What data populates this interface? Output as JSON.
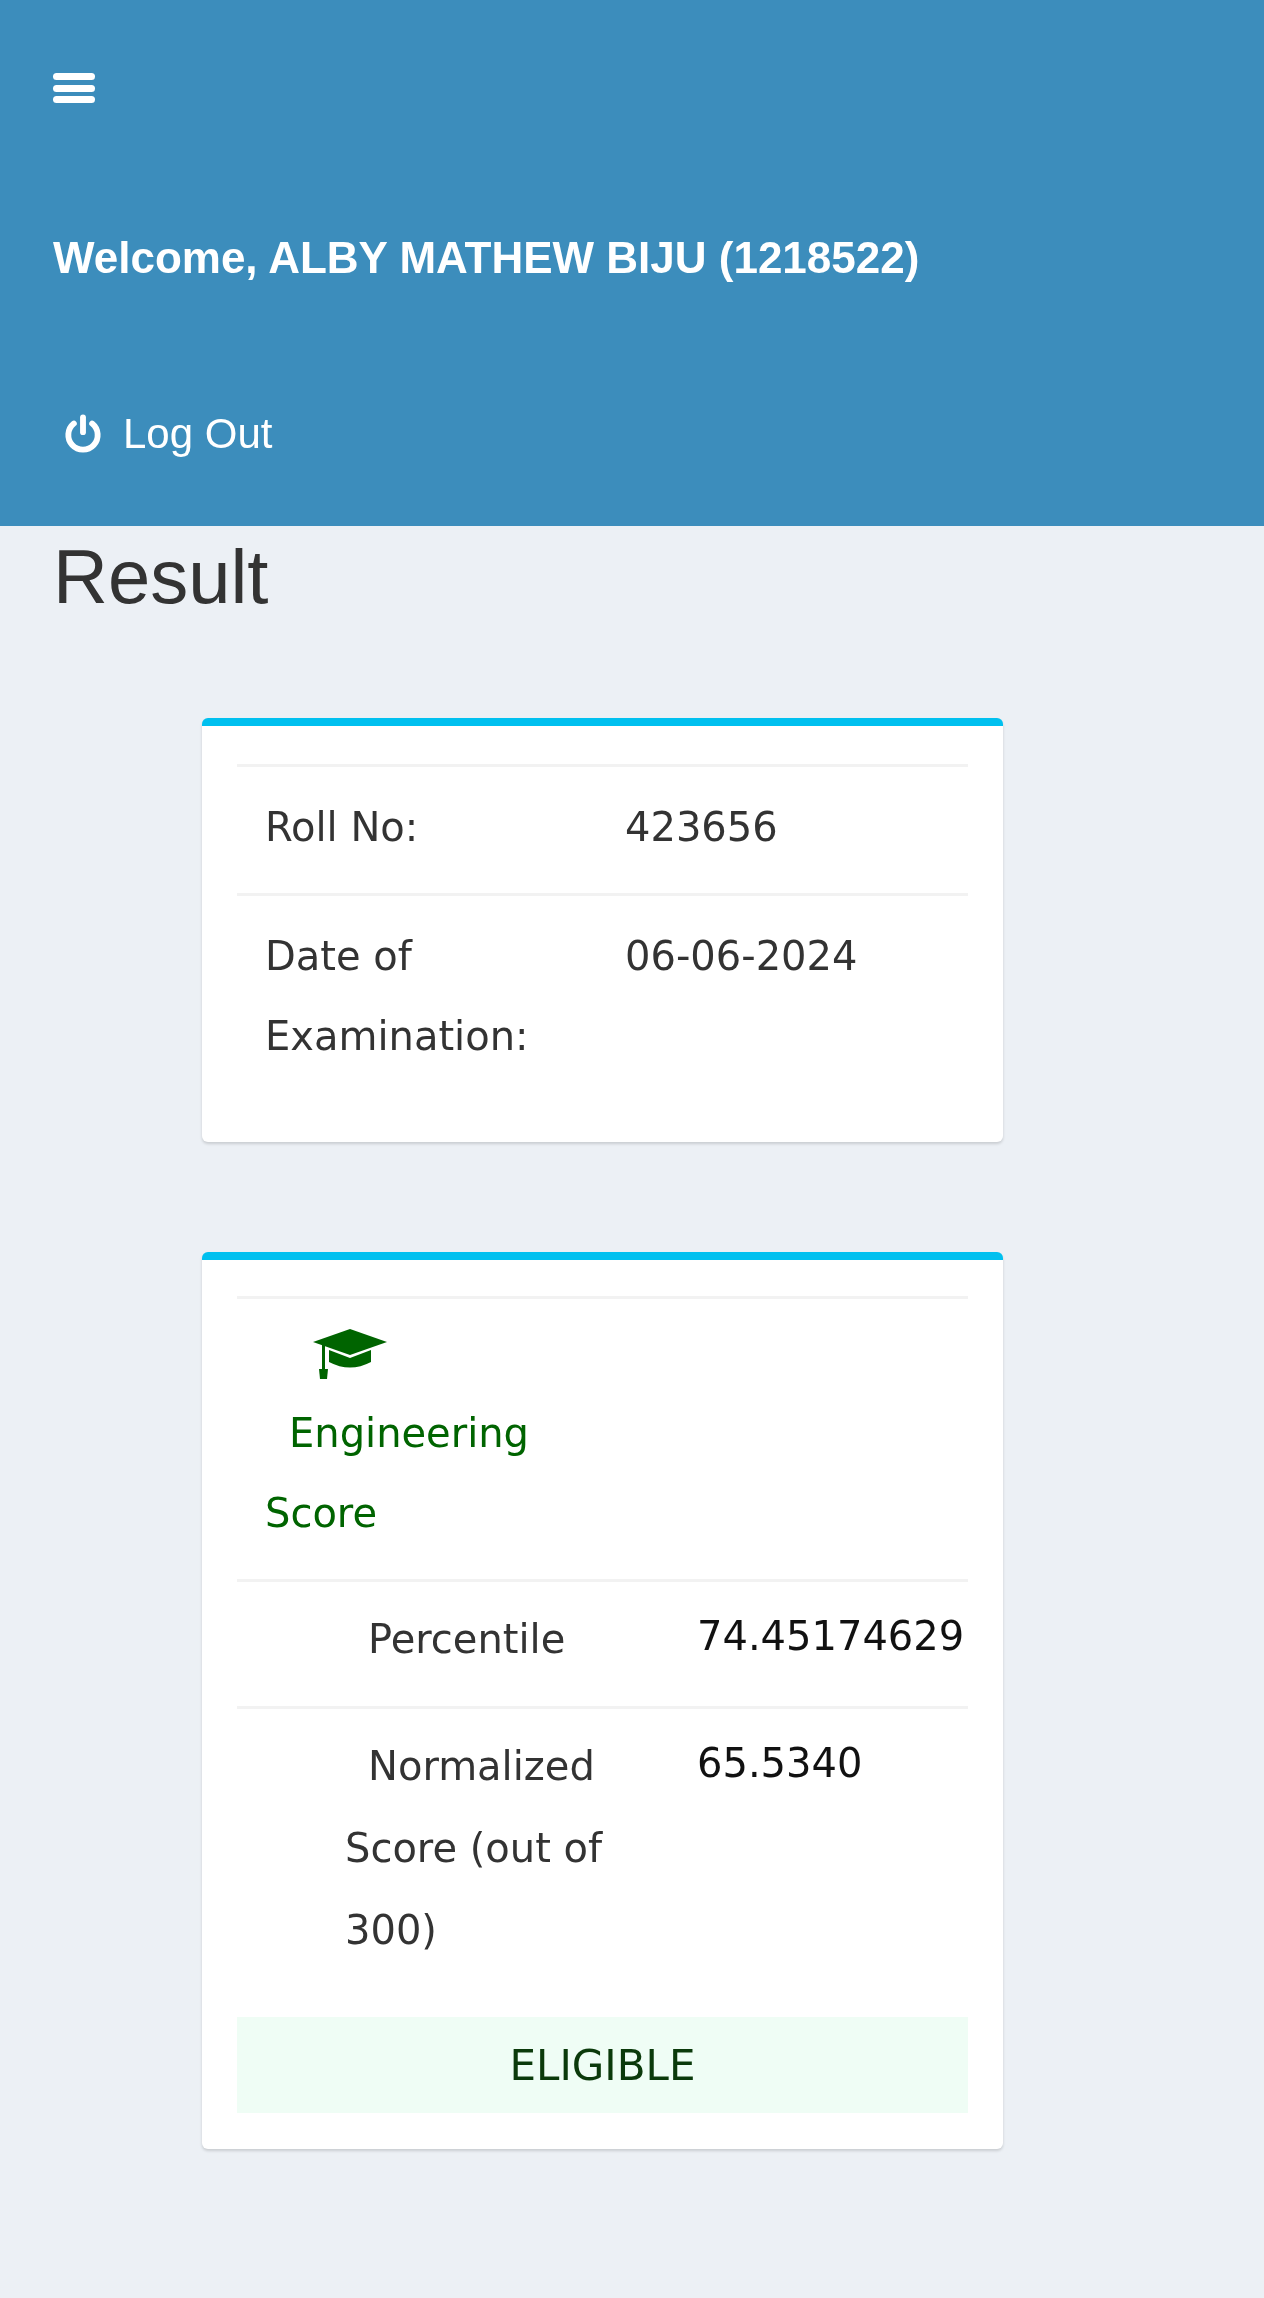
{
  "header": {
    "welcome": "Welcome, ALBY MATHEW BIJU (1218522)",
    "logout": "Log Out"
  },
  "page_title": "Result",
  "exam_card": {
    "rows": [
      {
        "label": "Roll No:",
        "value": "423656"
      },
      {
        "label": "Date of Examination:",
        "value": "06-06-2024"
      }
    ]
  },
  "score_card": {
    "title": "Engineering Score",
    "rows": [
      {
        "label": "Percentile",
        "value": "74.45174629"
      },
      {
        "label": "Normalized Score (out of 300)",
        "value": "65.5340"
      }
    ],
    "status": "ELIGIBLE"
  }
}
